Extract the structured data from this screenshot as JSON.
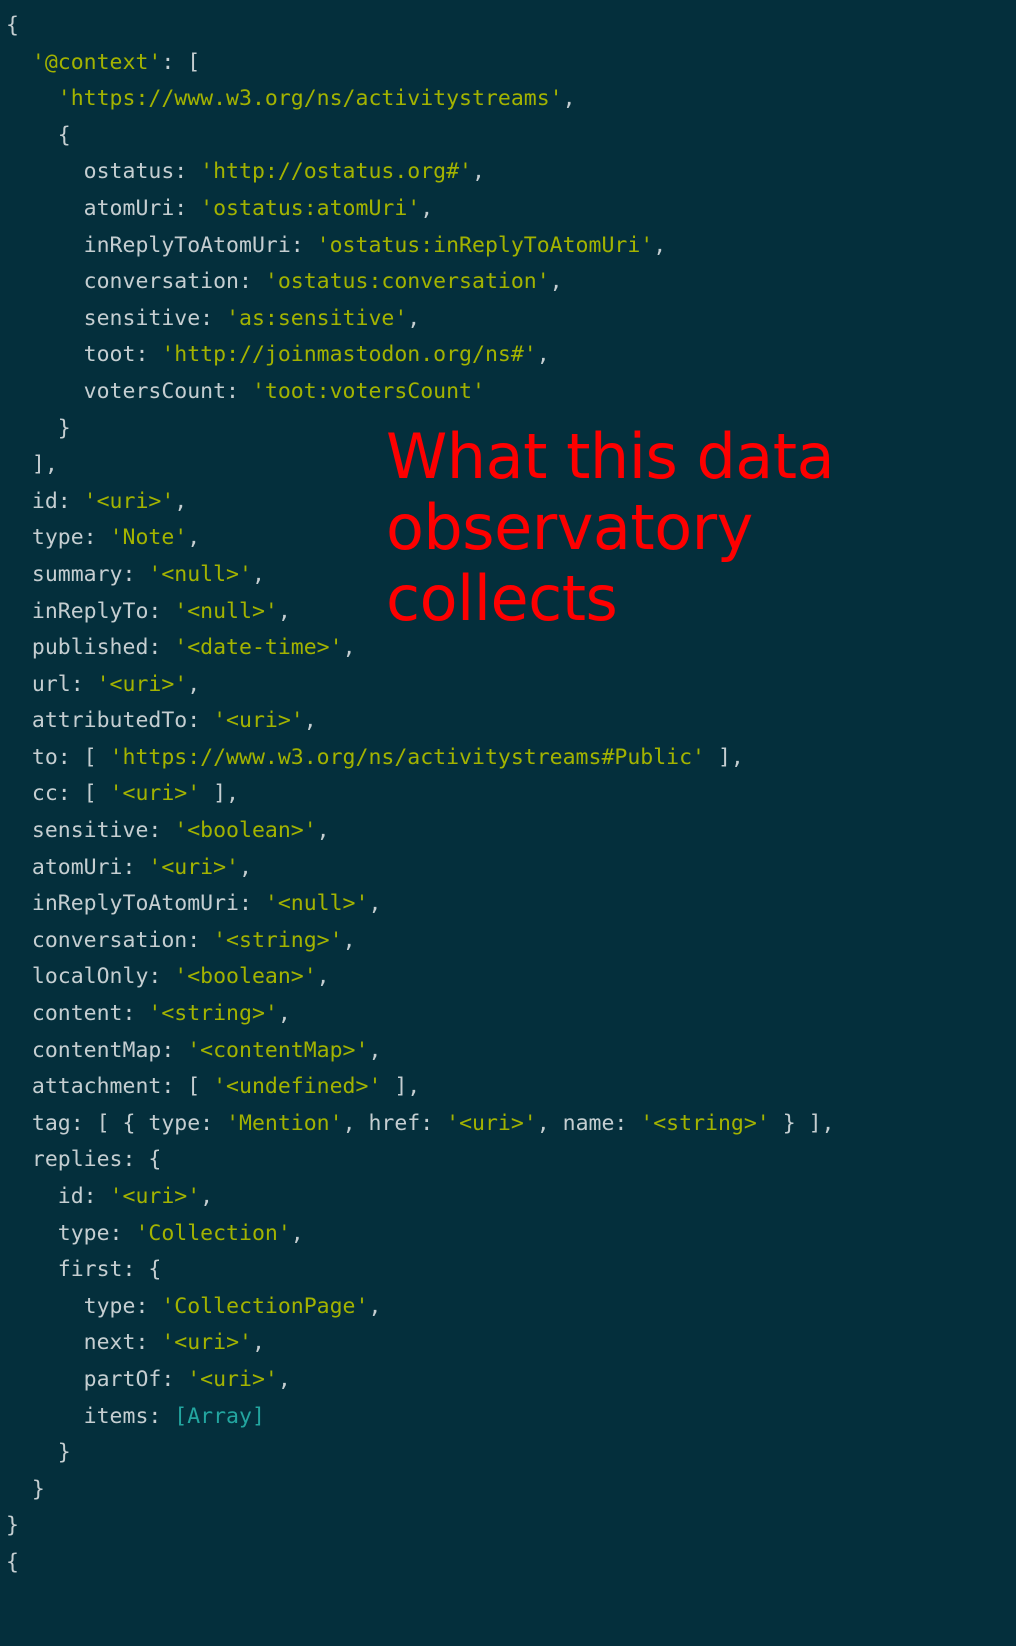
{
  "theme": {
    "background": "#042f3c",
    "key_color": "#c5ced1",
    "string_color": "#a3b300",
    "array_color": "#23a6a0",
    "annotation_color": "#fe0000"
  },
  "annotation": {
    "text": "What this data observatory collects"
  },
  "console_output": {
    "language": "javascript-object-inspect",
    "lines": [
      {
        "indent": 0,
        "tokens": [
          {
            "t": "punct",
            "v": "{"
          }
        ]
      },
      {
        "indent": 0,
        "tokens": [
          {
            "t": "punct",
            "v": "  "
          },
          {
            "t": "str",
            "v": "'@context'"
          },
          {
            "t": "punct",
            "v": ": ["
          }
        ]
      },
      {
        "indent": 0,
        "tokens": [
          {
            "t": "punct",
            "v": "    "
          },
          {
            "t": "str",
            "v": "'https://www.w3.org/ns/activitystreams'"
          },
          {
            "t": "punct",
            "v": ","
          }
        ]
      },
      {
        "indent": 0,
        "tokens": [
          {
            "t": "punct",
            "v": "    {"
          }
        ]
      },
      {
        "indent": 0,
        "tokens": [
          {
            "t": "key",
            "v": "      ostatus: "
          },
          {
            "t": "str",
            "v": "'http://ostatus.org#'"
          },
          {
            "t": "punct",
            "v": ","
          }
        ]
      },
      {
        "indent": 0,
        "tokens": [
          {
            "t": "key",
            "v": "      atomUri: "
          },
          {
            "t": "str",
            "v": "'ostatus:atomUri'"
          },
          {
            "t": "punct",
            "v": ","
          }
        ]
      },
      {
        "indent": 0,
        "tokens": [
          {
            "t": "key",
            "v": "      inReplyToAtomUri: "
          },
          {
            "t": "str",
            "v": "'ostatus:inReplyToAtomUri'"
          },
          {
            "t": "punct",
            "v": ","
          }
        ]
      },
      {
        "indent": 0,
        "tokens": [
          {
            "t": "key",
            "v": "      conversation: "
          },
          {
            "t": "str",
            "v": "'ostatus:conversation'"
          },
          {
            "t": "punct",
            "v": ","
          }
        ]
      },
      {
        "indent": 0,
        "tokens": [
          {
            "t": "key",
            "v": "      sensitive: "
          },
          {
            "t": "str",
            "v": "'as:sensitive'"
          },
          {
            "t": "punct",
            "v": ","
          }
        ]
      },
      {
        "indent": 0,
        "tokens": [
          {
            "t": "key",
            "v": "      toot: "
          },
          {
            "t": "str",
            "v": "'http://joinmastodon.org/ns#'"
          },
          {
            "t": "punct",
            "v": ","
          }
        ]
      },
      {
        "indent": 0,
        "tokens": [
          {
            "t": "key",
            "v": "      votersCount: "
          },
          {
            "t": "str",
            "v": "'toot:votersCount'"
          }
        ]
      },
      {
        "indent": 0,
        "tokens": [
          {
            "t": "punct",
            "v": "    }"
          }
        ]
      },
      {
        "indent": 0,
        "tokens": [
          {
            "t": "punct",
            "v": "  ],"
          }
        ]
      },
      {
        "indent": 0,
        "tokens": [
          {
            "t": "key",
            "v": "  id: "
          },
          {
            "t": "str",
            "v": "'<uri>'"
          },
          {
            "t": "punct",
            "v": ","
          }
        ]
      },
      {
        "indent": 0,
        "tokens": [
          {
            "t": "key",
            "v": "  type: "
          },
          {
            "t": "str",
            "v": "'Note'"
          },
          {
            "t": "punct",
            "v": ","
          }
        ]
      },
      {
        "indent": 0,
        "tokens": [
          {
            "t": "key",
            "v": "  summary: "
          },
          {
            "t": "str",
            "v": "'<null>'"
          },
          {
            "t": "punct",
            "v": ","
          }
        ]
      },
      {
        "indent": 0,
        "tokens": [
          {
            "t": "key",
            "v": "  inReplyTo: "
          },
          {
            "t": "str",
            "v": "'<null>'"
          },
          {
            "t": "punct",
            "v": ","
          }
        ]
      },
      {
        "indent": 0,
        "tokens": [
          {
            "t": "key",
            "v": "  published: "
          },
          {
            "t": "str",
            "v": "'<date-time>'"
          },
          {
            "t": "punct",
            "v": ","
          }
        ]
      },
      {
        "indent": 0,
        "tokens": [
          {
            "t": "key",
            "v": "  url: "
          },
          {
            "t": "str",
            "v": "'<uri>'"
          },
          {
            "t": "punct",
            "v": ","
          }
        ]
      },
      {
        "indent": 0,
        "tokens": [
          {
            "t": "key",
            "v": "  attributedTo: "
          },
          {
            "t": "str",
            "v": "'<uri>'"
          },
          {
            "t": "punct",
            "v": ","
          }
        ]
      },
      {
        "indent": 0,
        "tokens": [
          {
            "t": "key",
            "v": "  to: "
          },
          {
            "t": "punct",
            "v": "[ "
          },
          {
            "t": "str",
            "v": "'https://www.w3.org/ns/activitystreams#Public'"
          },
          {
            "t": "punct",
            "v": " ],"
          }
        ]
      },
      {
        "indent": 0,
        "tokens": [
          {
            "t": "key",
            "v": "  cc: "
          },
          {
            "t": "punct",
            "v": "[ "
          },
          {
            "t": "str",
            "v": "'<uri>'"
          },
          {
            "t": "punct",
            "v": " ],"
          }
        ]
      },
      {
        "indent": 0,
        "tokens": [
          {
            "t": "key",
            "v": "  sensitive: "
          },
          {
            "t": "str",
            "v": "'<boolean>'"
          },
          {
            "t": "punct",
            "v": ","
          }
        ]
      },
      {
        "indent": 0,
        "tokens": [
          {
            "t": "key",
            "v": "  atomUri: "
          },
          {
            "t": "str",
            "v": "'<uri>'"
          },
          {
            "t": "punct",
            "v": ","
          }
        ]
      },
      {
        "indent": 0,
        "tokens": [
          {
            "t": "key",
            "v": "  inReplyToAtomUri: "
          },
          {
            "t": "str",
            "v": "'<null>'"
          },
          {
            "t": "punct",
            "v": ","
          }
        ]
      },
      {
        "indent": 0,
        "tokens": [
          {
            "t": "key",
            "v": "  conversation: "
          },
          {
            "t": "str",
            "v": "'<string>'"
          },
          {
            "t": "punct",
            "v": ","
          }
        ]
      },
      {
        "indent": 0,
        "tokens": [
          {
            "t": "key",
            "v": "  localOnly: "
          },
          {
            "t": "str",
            "v": "'<boolean>'"
          },
          {
            "t": "punct",
            "v": ","
          }
        ]
      },
      {
        "indent": 0,
        "tokens": [
          {
            "t": "key",
            "v": "  content: "
          },
          {
            "t": "str",
            "v": "'<string>'"
          },
          {
            "t": "punct",
            "v": ","
          }
        ]
      },
      {
        "indent": 0,
        "tokens": [
          {
            "t": "key",
            "v": "  contentMap: "
          },
          {
            "t": "str",
            "v": "'<contentMap>'"
          },
          {
            "t": "punct",
            "v": ","
          }
        ]
      },
      {
        "indent": 0,
        "tokens": [
          {
            "t": "key",
            "v": "  attachment: "
          },
          {
            "t": "punct",
            "v": "[ "
          },
          {
            "t": "str",
            "v": "'<undefined>'"
          },
          {
            "t": "punct",
            "v": " ],"
          }
        ]
      },
      {
        "indent": 0,
        "tokens": [
          {
            "t": "key",
            "v": "  tag: "
          },
          {
            "t": "punct",
            "v": "[ { "
          },
          {
            "t": "key",
            "v": "type: "
          },
          {
            "t": "str",
            "v": "'Mention'"
          },
          {
            "t": "punct",
            "v": ", "
          },
          {
            "t": "key",
            "v": "href: "
          },
          {
            "t": "str",
            "v": "'<uri>'"
          },
          {
            "t": "punct",
            "v": ", "
          },
          {
            "t": "key",
            "v": "name: "
          },
          {
            "t": "str",
            "v": "'<string>'"
          },
          {
            "t": "punct",
            "v": " } ],"
          }
        ]
      },
      {
        "indent": 0,
        "tokens": [
          {
            "t": "key",
            "v": "  replies: "
          },
          {
            "t": "punct",
            "v": "{"
          }
        ]
      },
      {
        "indent": 0,
        "tokens": [
          {
            "t": "key",
            "v": "    id: "
          },
          {
            "t": "str",
            "v": "'<uri>'"
          },
          {
            "t": "punct",
            "v": ","
          }
        ]
      },
      {
        "indent": 0,
        "tokens": [
          {
            "t": "key",
            "v": "    type: "
          },
          {
            "t": "str",
            "v": "'Collection'"
          },
          {
            "t": "punct",
            "v": ","
          }
        ]
      },
      {
        "indent": 0,
        "tokens": [
          {
            "t": "key",
            "v": "    first: "
          },
          {
            "t": "punct",
            "v": "{"
          }
        ]
      },
      {
        "indent": 0,
        "tokens": [
          {
            "t": "key",
            "v": "      type: "
          },
          {
            "t": "str",
            "v": "'CollectionPage'"
          },
          {
            "t": "punct",
            "v": ","
          }
        ]
      },
      {
        "indent": 0,
        "tokens": [
          {
            "t": "key",
            "v": "      next: "
          },
          {
            "t": "str",
            "v": "'<uri>'"
          },
          {
            "t": "punct",
            "v": ","
          }
        ]
      },
      {
        "indent": 0,
        "tokens": [
          {
            "t": "key",
            "v": "      partOf: "
          },
          {
            "t": "str",
            "v": "'<uri>'"
          },
          {
            "t": "punct",
            "v": ","
          }
        ]
      },
      {
        "indent": 0,
        "tokens": [
          {
            "t": "key",
            "v": "      items: "
          },
          {
            "t": "arr",
            "v": "[Array]"
          }
        ]
      },
      {
        "indent": 0,
        "tokens": [
          {
            "t": "punct",
            "v": "    }"
          }
        ]
      },
      {
        "indent": 0,
        "tokens": [
          {
            "t": "punct",
            "v": "  }"
          }
        ]
      },
      {
        "indent": 0,
        "tokens": [
          {
            "t": "punct",
            "v": "}"
          }
        ]
      },
      {
        "indent": 0,
        "tokens": [
          {
            "t": "punct",
            "v": "{"
          }
        ]
      }
    ]
  }
}
